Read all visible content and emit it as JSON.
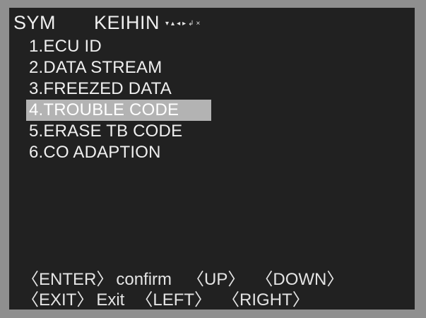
{
  "header": {
    "brand": "SYM",
    "model": "KEIHIN",
    "nav_glyphs": [
      "▾",
      "▴",
      "◂",
      "▸",
      "↲",
      "×"
    ]
  },
  "menu": {
    "items": [
      {
        "label": "1.ECU ID"
      },
      {
        "label": "2.DATA STREAM"
      },
      {
        "label": "3.FREEZED DATA"
      },
      {
        "label": "4.TROUBLE CODE"
      },
      {
        "label": "5.ERASE TB CODE"
      },
      {
        "label": "6.CO ADAPTION"
      }
    ],
    "selected_index": 3
  },
  "footer": {
    "line1": {
      "enter_key": "〈ENTER〉",
      "enter_action": "confirm",
      "up_key": "〈UP〉",
      "down_key": "〈DOWN〉"
    },
    "line2": {
      "exit_key": "〈EXIT〉",
      "exit_action": "Exit",
      "left_key": "〈LEFT〉",
      "right_key": "〈RIGHT〉"
    }
  },
  "colors": {
    "bezel": "#8f8f8f",
    "screen": "#212121",
    "text": "#efefef",
    "highlight": "#b3b3b3"
  }
}
